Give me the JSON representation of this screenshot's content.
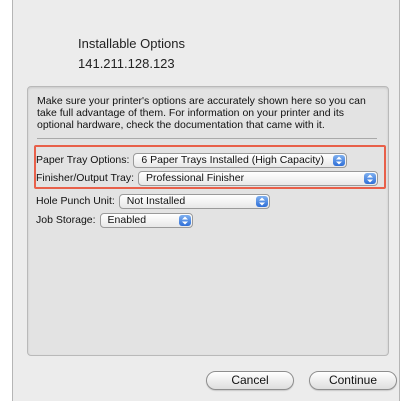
{
  "header": {
    "title": "Installable Options",
    "address": "141.211.128.123"
  },
  "description": "Make sure your printer's options are accurately shown here so you can take full advantage of them.  For information on your printer and its optional hardware, check the documentation that came with it.",
  "options": {
    "paper_tray": {
      "label": "Paper Tray Options:",
      "value": "6 Paper Trays Installed (High Capacity)"
    },
    "finisher": {
      "label": "Finisher/Output Tray:",
      "value": "Professional Finisher"
    },
    "hole_punch": {
      "label": "Hole Punch Unit:",
      "value": "Not Installed"
    },
    "job_storage": {
      "label": "Job Storage:",
      "value": "Enabled"
    }
  },
  "buttons": {
    "cancel": "Cancel",
    "continue": "Continue"
  },
  "colors": {
    "highlight_border": "#e8604a",
    "popup_arrow_blue": "#2f6fd8",
    "sheet_background": "#ececec"
  },
  "icons": {
    "popup_arrows": "up-down-arrows-icon"
  }
}
